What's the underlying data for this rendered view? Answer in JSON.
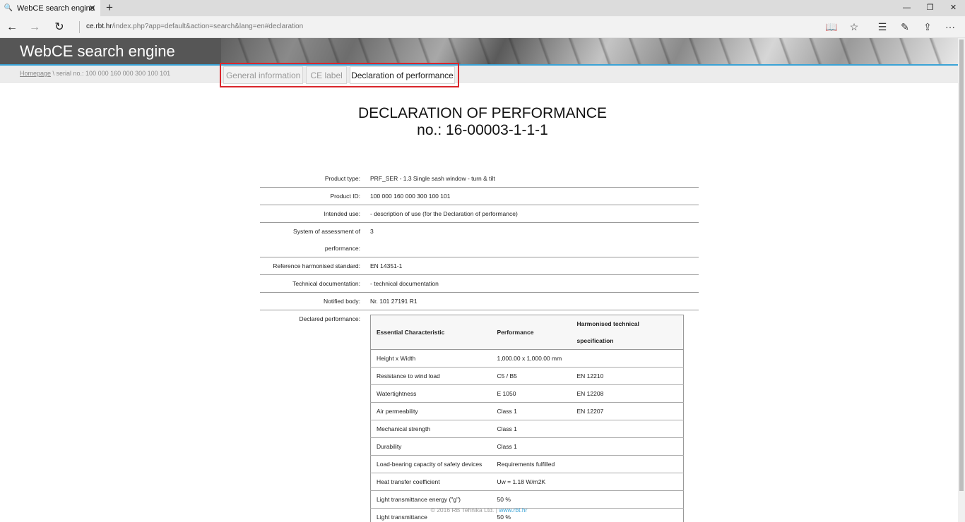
{
  "browser": {
    "tab_title": "WebCE search engine",
    "url_host": "ce.rbt.hr",
    "url_path": "/index.php?app=default&action=search&lang=en#declaration"
  },
  "site": {
    "title": "WebCE search engine",
    "breadcrumb_home": "Homepage",
    "breadcrumb_rest": " \\ serial no.: 100 000 160 000 300 100 101",
    "tabs": [
      "General information",
      "CE label",
      "Declaration of performance"
    ],
    "active_tab": "Declaration of performance"
  },
  "doc": {
    "title": "DECLARATION OF PERFORMANCE",
    "number": "no.: 16-00003-1-1-1",
    "fields": [
      {
        "label": "Product type:",
        "value": "PRF_SER - 1.3 Single sash window - turn & tilt"
      },
      {
        "label": "Product ID:",
        "value": "100 000 160 000 300 100 101"
      },
      {
        "label": "Intended use:",
        "value": "- description of use (for the Declaration of performance)"
      },
      {
        "label": "System of assessment of performance:",
        "value": "3"
      },
      {
        "label": "Reference harmonised standard:",
        "value": "EN 14351-1"
      },
      {
        "label": "Technical documentation:",
        "value": "- technical documentation"
      },
      {
        "label": "Notified body:",
        "value": "Nr. 101 27191 R1"
      }
    ],
    "declared_label": "Declared performance:",
    "table_headers": [
      "Essential Characteristic",
      "Performance",
      "Harmonised technical specification"
    ],
    "table_rows": [
      [
        "Height x Width",
        "1,000.00 x 1,000.00 mm",
        ""
      ],
      [
        "Resistance to wind load",
        "C5 / B5",
        "EN 12210"
      ],
      [
        "Watertightness",
        "E 1050",
        "EN 12208"
      ],
      [
        "Air permeability",
        "Class 1",
        "EN 12207"
      ],
      [
        "Mechanical strength",
        "Class 1",
        ""
      ],
      [
        "Durability",
        "Class 1",
        ""
      ],
      [
        "Load-bearing capacity of safety devices",
        "Requirements fulfilled",
        ""
      ],
      [
        "Heat transfer coefficient",
        "Uw = 1.18 W/m2K",
        ""
      ],
      [
        "Light transmittance energy (\"g\")",
        "50 %",
        ""
      ],
      [
        "Light transmittance",
        "50 %",
        ""
      ]
    ]
  },
  "footer": {
    "copyright": "© 2016 RB Tehnika Ltd. | ",
    "link": "www.rbt.hr"
  }
}
